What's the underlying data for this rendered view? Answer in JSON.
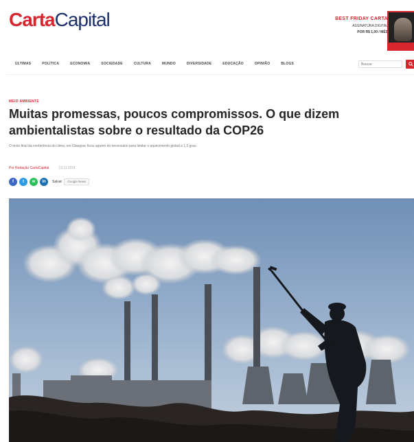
{
  "header": {
    "logo_part1": "Carta",
    "logo_part2": "Capital",
    "promo": {
      "title": "BEST FRIDAY CARTA",
      "line1": "ASSINATURA DIGITAL",
      "line2": "POR R$ 1,00 / MÊS",
      "icon": "magazine-cover"
    }
  },
  "nav": {
    "items": [
      "Últimas",
      "Política",
      "Economia",
      "Sociedade",
      "Cultura",
      "Mundo",
      "Diversidade",
      "Educação",
      "Opinião",
      "Blogs"
    ],
    "search_placeholder": "Buscar",
    "search_icon": "search-icon"
  },
  "article": {
    "kicker": "Meio Ambiente",
    "headline": "Muitas promessas, poucos compromissos. O que dizem ambientalistas sobre o resultado da COP26",
    "subhead": "O texto final da conferência do clima, em Glasgow, ficou aquém do necessário para limitar o aquecimento global a 1,5 grau",
    "byline_author": "Por Redação CartaCapital",
    "byline_date": "13.11.2021",
    "share": {
      "buttons": [
        "f",
        "t",
        "w",
        "in"
      ],
      "save_label": "Salvar",
      "follow_label": "Google News"
    }
  },
  "colors": {
    "brand_red": "#d7262e",
    "brand_blue": "#1b2f6b"
  }
}
